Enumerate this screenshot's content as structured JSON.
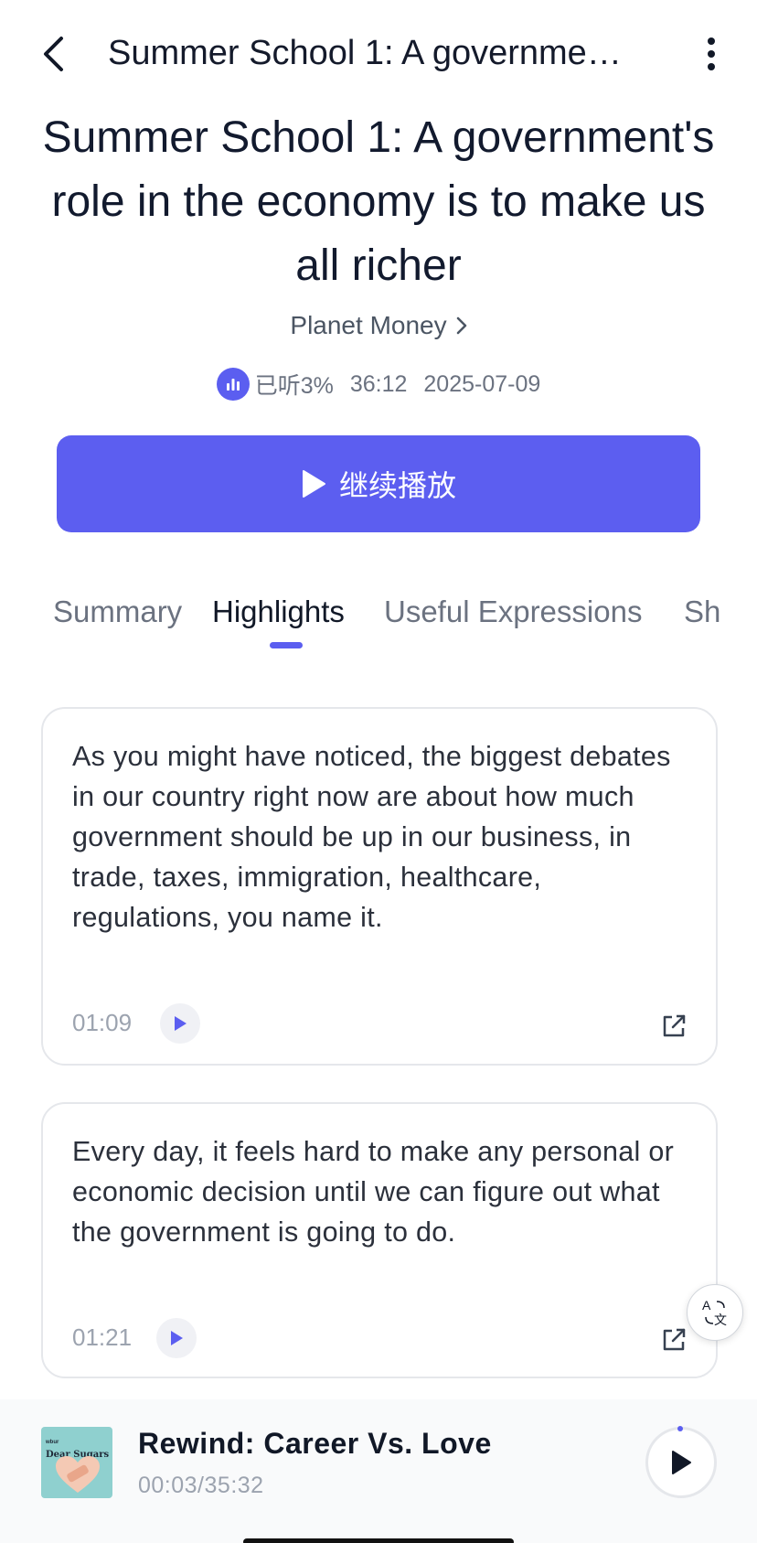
{
  "header": {
    "title": "Summer School 1: A governme…"
  },
  "episode": {
    "title": "Summer School 1: A government's role in the economy is to make us all richer",
    "podcast": "Planet Money",
    "listened": "已听3%",
    "duration": "36:12",
    "date": "2025-07-09"
  },
  "continue_button": {
    "label": "继续播放"
  },
  "tabs": [
    "Summary",
    "Highlights",
    "Useful Expressions",
    "Sh"
  ],
  "highlights": [
    {
      "text": "As you might have noticed, the biggest debates in our country right now are about how much government should be up in our business, in trade, taxes, immigration, healthcare, regulations, you name it.",
      "time": "01:09"
    },
    {
      "text": "Every day, it feels hard to make any personal or economic decision until we can figure out what the government is going to do.",
      "time": "01:21"
    }
  ],
  "now_playing": {
    "title": "Rewind: Career Vs. Love",
    "time": "00:03/35:32",
    "cover_label": "Dear Sugars",
    "cover_brand": "wbur"
  },
  "colors": {
    "accent": "#5C5EF0",
    "text_primary": "#111827",
    "text_muted": "#9CA3AF"
  }
}
